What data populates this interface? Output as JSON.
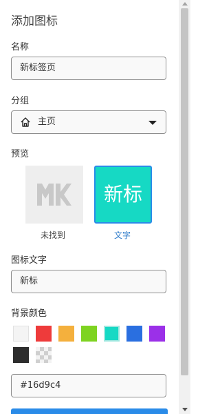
{
  "title": "添加图标",
  "name_label": "名称",
  "name_value": "新标签页",
  "group_label": "分组",
  "group_value": "主页",
  "preview_label": "预览",
  "preview": {
    "missing_caption": "未找到",
    "text_caption": "文字",
    "text_glyph": "新标",
    "icon": "mk-logo-placeholder-icon"
  },
  "icon_text_label": "图标文字",
  "icon_text_value": "新标",
  "bg_color_label": "背景颜色",
  "swatches": [
    {
      "color": "#f4f4f4",
      "name": "white"
    },
    {
      "color": "#ee3b3b",
      "name": "red"
    },
    {
      "color": "#f4b03d",
      "name": "orange"
    },
    {
      "color": "#7ed321",
      "name": "green"
    },
    {
      "color": "#16d9c4",
      "name": "teal",
      "selected": true
    },
    {
      "color": "#2a6fe0",
      "name": "blue"
    },
    {
      "color": "#9b30e8",
      "name": "purple"
    },
    {
      "color": "#2d2d2d",
      "name": "black"
    },
    {
      "color": "transparent",
      "name": "transparent"
    }
  ],
  "color_value": "#16d9c4",
  "colors": {
    "accent": "#2a8be8",
    "selected_bg": "#16d9c4"
  }
}
